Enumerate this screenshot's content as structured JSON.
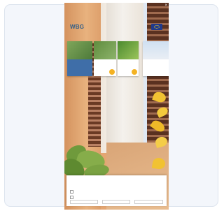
{
  "preview": {
    "logo_text": "WBG",
    "logo_subtext": "",
    "close_glyph": "×",
    "eu_caption": "",
    "tiles": [
      {
        "label": "",
        "kind": "blue"
      },
      {
        "label": "",
        "kind": "white"
      },
      {
        "label": "",
        "kind": "white"
      },
      {
        "label": "",
        "kind": "white"
      }
    ],
    "cookie": {
      "text": "",
      "rows": [
        {
          "label": "",
          "value": ""
        },
        {
          "label": "",
          "value": ""
        }
      ],
      "buttons": [
        "",
        "",
        ""
      ]
    }
  },
  "colors": {
    "card_background": "#f3f6fb",
    "wall": "#e4a672",
    "shutter": "#6a3a24",
    "brand_blue": "#2f5f8a",
    "accent_orange": "#f4b223",
    "foliage": "#6f9a3c",
    "yellow_flower": "#f1c232"
  }
}
